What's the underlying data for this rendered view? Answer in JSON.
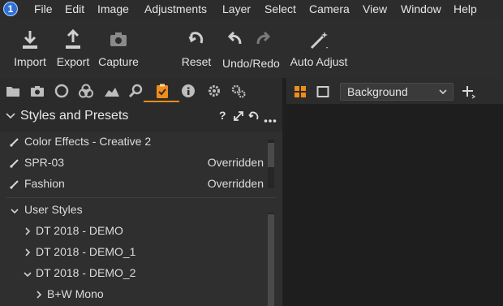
{
  "menu": {
    "logo": "1",
    "items": [
      "File",
      "Edit",
      "Image",
      "Adjustments",
      "Layer",
      "Select",
      "Camera",
      "View",
      "Window",
      "Help"
    ]
  },
  "toolbar": {
    "import": "Import",
    "export": "Export",
    "capture": "Capture",
    "reset": "Reset",
    "undo_redo": "Undo/Redo",
    "auto_adjust": "Auto Adjust"
  },
  "viewer": {
    "background_select": "Background"
  },
  "panel": {
    "title": "Styles and Presets",
    "help": "?"
  },
  "applied_styles": [
    {
      "name": "Color Effects - Creative 2",
      "status": ""
    },
    {
      "name": "SPR-03",
      "status": "Overridden"
    },
    {
      "name": "Fashion",
      "status": "Overridden"
    }
  ],
  "user_styles": {
    "label": "User Styles",
    "items": [
      {
        "name": "DT 2018 - DEMO",
        "expanded": false
      },
      {
        "name": "DT 2018 - DEMO_1",
        "expanded": false
      },
      {
        "name": "DT 2018 - DEMO_2",
        "expanded": true
      }
    ],
    "sub_items": [
      "B+W Mono"
    ]
  },
  "colors": {
    "accent": "#f08c1a",
    "logo": "#2e6fd6"
  }
}
